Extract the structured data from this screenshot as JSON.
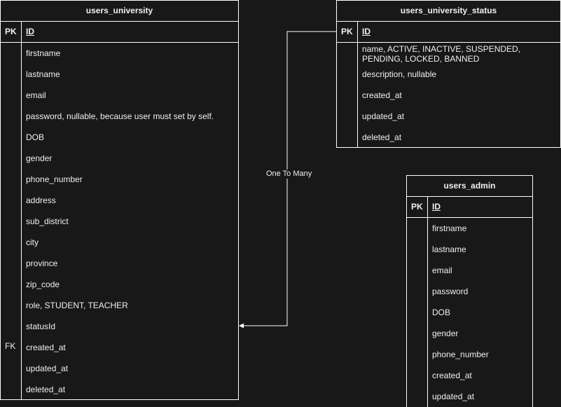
{
  "users_university": {
    "title": "users_university",
    "pk_label": "PK",
    "pk_field": "ID",
    "fk_label": "FK",
    "fields": [
      "firstname",
      "lastname",
      "email",
      "password, nullable, because user must set by self.",
      "DOB",
      "gender",
      "phone_number",
      "address",
      "sub_district",
      "city",
      "province",
      "zip_code",
      "role, STUDENT, TEACHER",
      "statusId",
      "created_at",
      "updated_at",
      "deleted_at"
    ]
  },
  "users_university_status": {
    "title": "users_university_status",
    "pk_label": "PK",
    "pk_field": "ID",
    "fields": [
      "name, ACTIVE, INACTIVE, SUSPENDED, PENDING, LOCKED, BANNED",
      "description, nullable",
      "created_at",
      "updated_at",
      "deleted_at"
    ]
  },
  "users_admin": {
    "title": "users_admin",
    "pk_label": "PK",
    "pk_field": "ID",
    "fields": [
      "firstname",
      "lastname",
      "email",
      "password",
      "DOB",
      "gender",
      "phone_number",
      "created_at",
      "updated_at"
    ]
  },
  "relation": {
    "label": "One To Many"
  },
  "colors": {
    "background": "#181818",
    "line": "#ffffff",
    "text": "#f0f0f0"
  }
}
